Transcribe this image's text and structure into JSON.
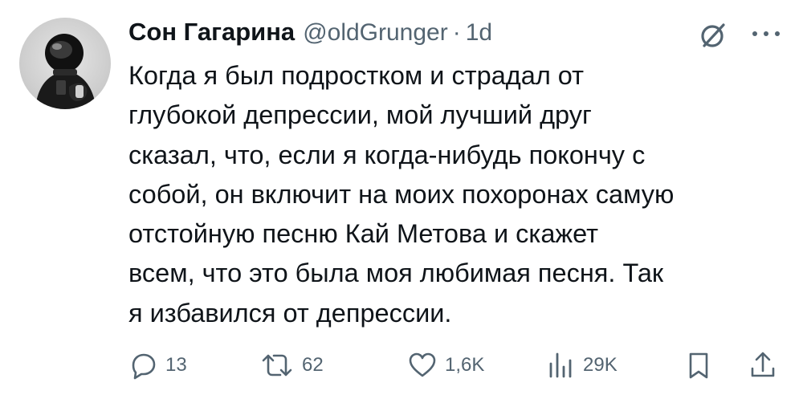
{
  "tweet": {
    "display_name": "Сон Гагарина",
    "handle": "@oldGrunger",
    "separator": "·",
    "time": "1d",
    "text": "Когда я был подростком и страдал от\nглубокой депрессии, мой лучший друг\nсказал, что, если я когда-нибудь покончу с\nсобой, он включит на моих похоронах самую\nотстойную песню Кай Метова и скажет\nвсем, что это была моя любимая песня. Так\nя избавился от депрессии.",
    "icons": {
      "avatar": "astronaut-avatar",
      "top_right": [
        "grok-icon",
        "more-icon"
      ]
    },
    "actions": {
      "replies": "13",
      "reposts": "62",
      "likes": "1,6K",
      "views": "29K"
    },
    "colors": {
      "text": "#0f1419",
      "secondary": "#536471",
      "background": "#ffffff"
    }
  }
}
